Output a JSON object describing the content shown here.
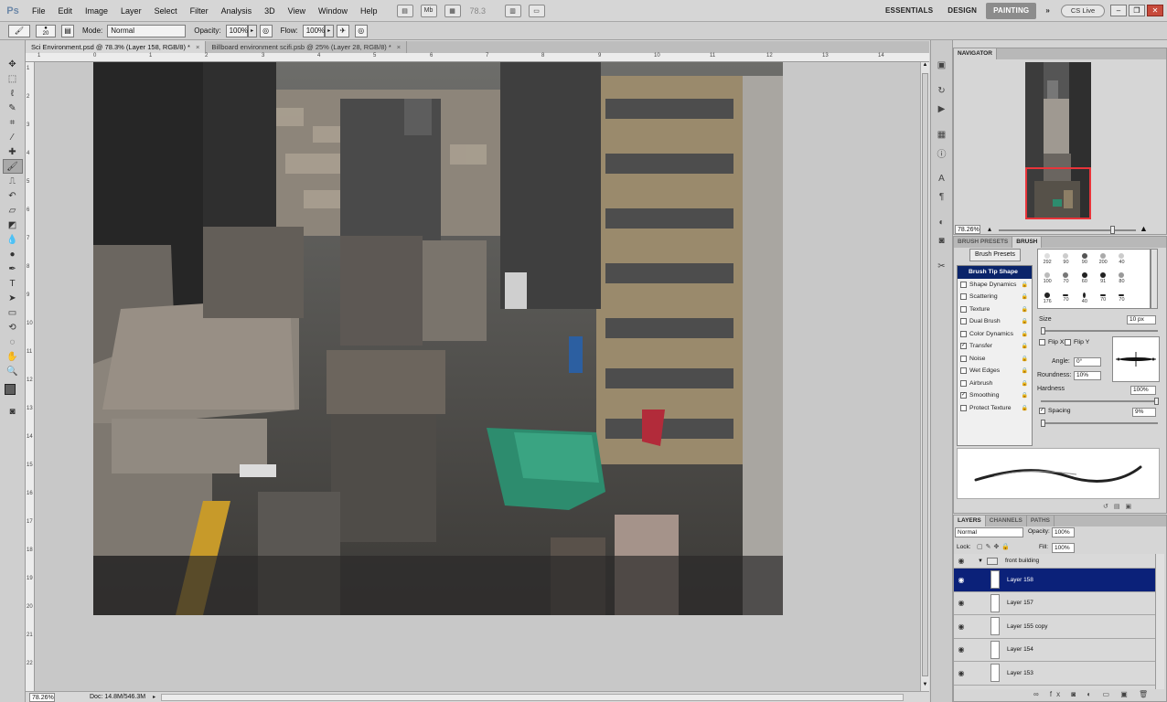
{
  "app": {
    "logo": "Ps"
  },
  "menu": [
    "File",
    "Edit",
    "Image",
    "Layer",
    "Select",
    "Filter",
    "Analysis",
    "3D",
    "View",
    "Window",
    "Help"
  ],
  "menubar": {
    "zoom": "78.3"
  },
  "workspaces": [
    {
      "label": "ESSENTIALS",
      "active": false
    },
    {
      "label": "DESIGN",
      "active": false
    },
    {
      "label": "PAINTING",
      "active": true
    }
  ],
  "cslive": "CS Live",
  "options": {
    "brush_size": "20",
    "mode_label": "Mode:",
    "mode_value": "Normal",
    "opacity_label": "Opacity:",
    "opacity_value": "100%",
    "flow_label": "Flow:",
    "flow_value": "100%"
  },
  "tabs": [
    {
      "label": "Sci Environment.psd @ 78.3% (Layer 158, RGB/8) *",
      "active": true
    },
    {
      "label": "Billboard environment scifi.psb @ 25% (Layer 28, RGB/8) *",
      "active": false
    }
  ],
  "ruler_top": [
    "1",
    "0",
    "1",
    "2",
    "3",
    "4",
    "5",
    "6",
    "7",
    "8",
    "9",
    "10",
    "11",
    "12",
    "13",
    "14"
  ],
  "ruler_left": [
    "1",
    "2",
    "3",
    "4",
    "5",
    "6",
    "7",
    "8",
    "9",
    "10",
    "11",
    "12",
    "13",
    "14",
    "15",
    "16",
    "17",
    "18",
    "19",
    "20",
    "21",
    "22"
  ],
  "status": {
    "zoom": "78.26%",
    "doc": "Doc: 14.8M/546.3M"
  },
  "navigator": {
    "tab": "NAVIGATOR",
    "zoom": "78.26%"
  },
  "brush_panel": {
    "tabs": [
      "BRUSH PRESETS",
      "BRUSH"
    ],
    "presets_button": "Brush Presets",
    "options": [
      {
        "label": "Brush Tip Shape",
        "checked": false,
        "active": true
      },
      {
        "label": "Shape Dynamics",
        "checked": false
      },
      {
        "label": "Scattering",
        "checked": false
      },
      {
        "label": "Texture",
        "checked": false
      },
      {
        "label": "Dual Brush",
        "checked": false
      },
      {
        "label": "Color Dynamics",
        "checked": false
      },
      {
        "label": "Transfer",
        "checked": true
      },
      {
        "label": "Noise",
        "checked": false
      },
      {
        "label": "Wet Edges",
        "checked": false
      },
      {
        "label": "Airbrush",
        "checked": false
      },
      {
        "label": "Smoothing",
        "checked": true
      },
      {
        "label": "Protect Texture",
        "checked": false
      }
    ],
    "tips": [
      "292",
      "90",
      "90",
      "200",
      "40",
      "",
      "100",
      "70",
      "60",
      "91",
      "80",
      "",
      "176",
      "70",
      "40",
      "70",
      "70",
      ""
    ],
    "size_label": "Size",
    "size_value": "10 px",
    "flip_x": "Flip X",
    "flip_y": "Flip Y",
    "angle_label": "Angle:",
    "angle_value": "0°",
    "roundness_label": "Roundness:",
    "roundness_value": "10%",
    "hardness_label": "Hardness",
    "hardness_value": "100%",
    "spacing_label": "Spacing",
    "spacing_value": "9%"
  },
  "layers_panel": {
    "tabs": [
      "LAYERS",
      "CHANNELS",
      "PATHS"
    ],
    "blend_mode": "Normal",
    "opacity_label": "Opacity:",
    "opacity_value": "100%",
    "lock_label": "Lock:",
    "fill_label": "Fill:",
    "fill_value": "100%",
    "group": "front building",
    "layers": [
      {
        "name": "Layer 158",
        "selected": true
      },
      {
        "name": "Layer 157",
        "selected": false
      },
      {
        "name": "Layer 155 copy",
        "selected": false
      },
      {
        "name": "Layer 154",
        "selected": false
      },
      {
        "name": "Layer 153",
        "selected": false
      }
    ]
  },
  "colors": {
    "selection": "#0b2179",
    "active_option": "#0a246a",
    "nav_viewbox": "#e8343a",
    "workspace_active": "#8c8c8c"
  }
}
